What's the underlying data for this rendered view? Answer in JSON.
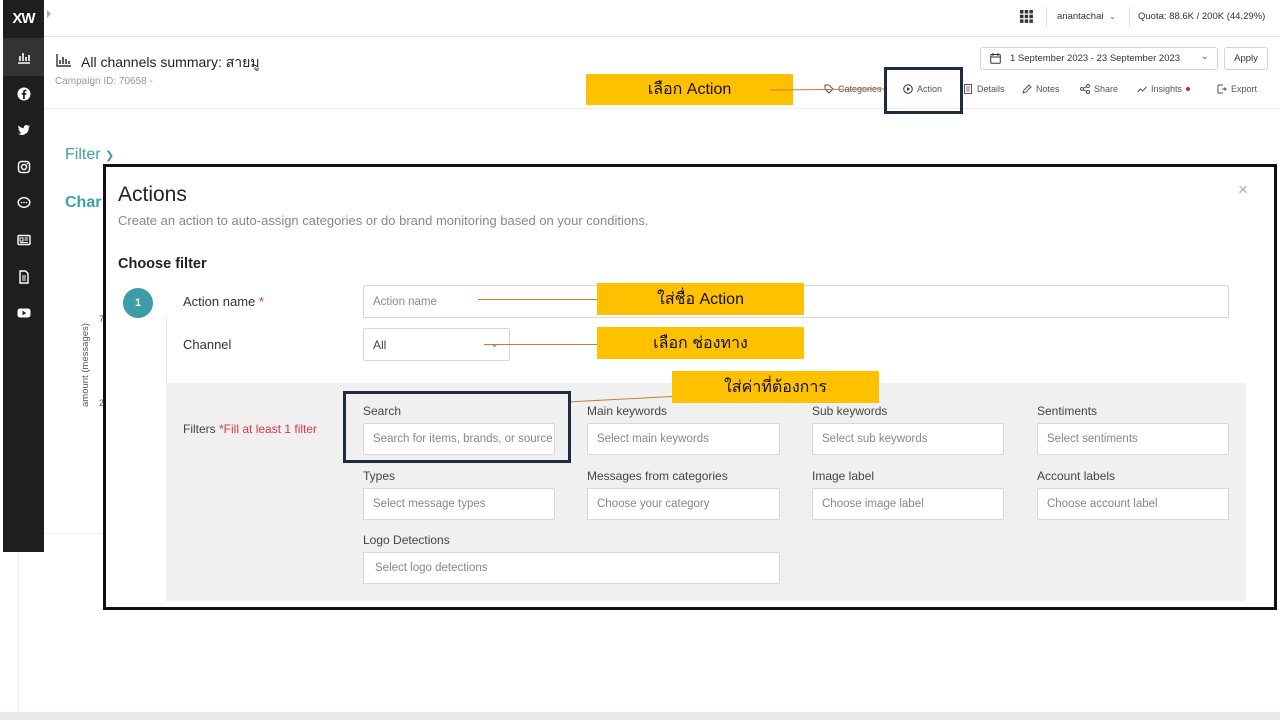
{
  "sidebar": {
    "logo_text": "XW",
    "items": [
      {
        "icon": "bar-chart-icon"
      },
      {
        "icon": "facebook-icon"
      },
      {
        "icon": "twitter-icon"
      },
      {
        "icon": "instagram-icon"
      },
      {
        "icon": "chat-icon"
      },
      {
        "icon": "news-icon"
      },
      {
        "icon": "document-icon"
      },
      {
        "icon": "youtube-icon"
      }
    ]
  },
  "topbar": {
    "user": "anantachai",
    "quota": "Quota: 88.6K / 200K (44.29%)"
  },
  "header": {
    "title": "All channels summary: สายมู",
    "campaign_id": "Campaign ID: 70658 -",
    "date_range": "1 September 2023 - 23 September 2023",
    "apply_label": "Apply",
    "toolbar": {
      "categories": "Categories",
      "action": "Action",
      "details": "Details",
      "notes": "Notes",
      "share": "Share",
      "insights": "Insights",
      "export": "Export"
    }
  },
  "background": {
    "filter_label": "Filter",
    "chart_label": "Char",
    "yaxis_label": "amount (messages)",
    "tick1": "7",
    "tick2": "2"
  },
  "callouts": {
    "select_action": "เลือก Action",
    "enter_name": "ใส่ชื่อ Action",
    "select_channel": "เลือก ช่องทาง",
    "enter_values": "ใส่ค่าที่ต้องการ"
  },
  "modal": {
    "title": "Actions",
    "subtitle": "Create an action to auto-assign categories or do brand monitoring based on your conditions.",
    "close": "×",
    "section_title": "Choose filter",
    "step_number": "1",
    "action_name_label": "Action name",
    "required_mark": "*",
    "action_name_placeholder": "Action name",
    "channel_label": "Channel",
    "channel_value": "All",
    "filters_label": "Filters",
    "filters_hint": "*Fill at least 1 filter",
    "filters": {
      "search": {
        "label": "Search",
        "placeholder": "Search for items, brands, or source"
      },
      "main_keywords": {
        "label": "Main keywords",
        "placeholder": "Select main keywords"
      },
      "sub_keywords": {
        "label": "Sub keywords",
        "placeholder": "Select sub keywords"
      },
      "sentiments": {
        "label": "Sentiments",
        "placeholder": "Select sentiments"
      },
      "types": {
        "label": "Types",
        "placeholder": "Select message types"
      },
      "messages_from_categories": {
        "label": "Messages from categories",
        "placeholder": "Choose your category"
      },
      "image_label": {
        "label": "Image label",
        "placeholder": "Choose image label"
      },
      "account_labels": {
        "label": "Account labels",
        "placeholder": "Choose account label"
      },
      "logo_detections": {
        "label": "Logo Detections",
        "placeholder": "Select logo detections"
      }
    }
  },
  "colors": {
    "accent_teal": "#3c9da7",
    "callout_yellow": "#ffc000",
    "highlight_navy": "#1f2a44",
    "required_red": "#e0344a"
  }
}
